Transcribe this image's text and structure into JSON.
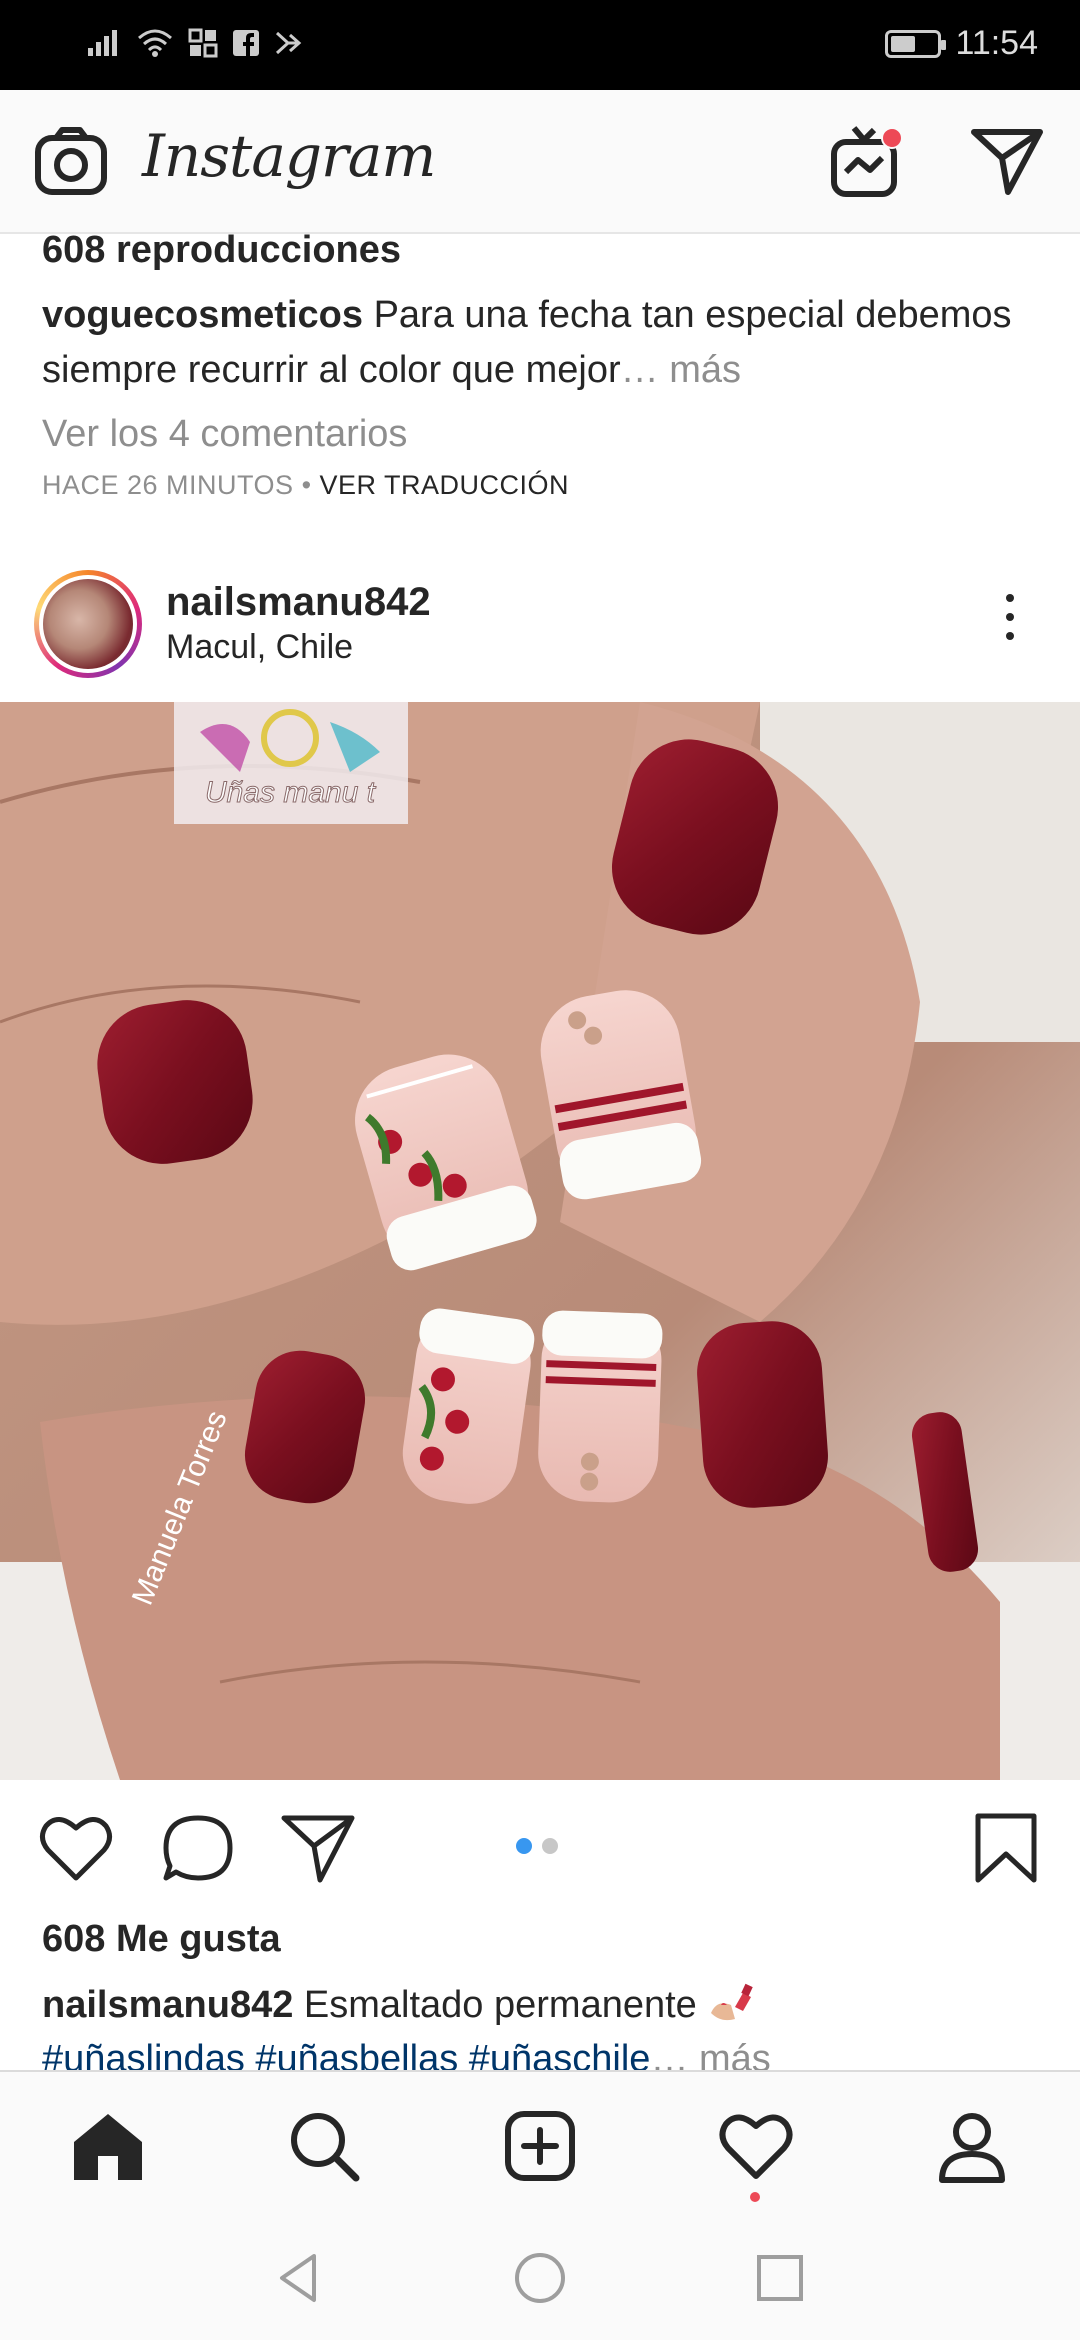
{
  "status_bar": {
    "time": "11:54",
    "icons": [
      "signal-icon",
      "wifi-icon",
      "nfc-icon",
      "facebook-icon",
      "notification-icon",
      "battery-icon"
    ],
    "battery_level": 0.55
  },
  "header": {
    "title": "Instagram",
    "icons": [
      "camera-icon",
      "igtv-icon",
      "direct-message-icon"
    ],
    "igtv_badge_color": "#ed4956"
  },
  "previous_post": {
    "views": "608 reproducciones",
    "username": "voguecosmeticos",
    "caption": "Para una fecha tan especial debemos siempre recurrir al color que mejor",
    "more": "… más",
    "comments_link": "Ver los 4 comentarios",
    "time_ago": "HACE 26 MINUTOS",
    "separator": " • ",
    "translate": "VER TRADUCCIÓN"
  },
  "post": {
    "username": "nailsmanu842",
    "location": "Macul, Chile",
    "image": {
      "watermark_logo": "Uñas manu t",
      "signature": "Manuela Torres"
    },
    "carousel": {
      "count": 2,
      "active": 0
    },
    "likes": "608 Me gusta",
    "caption_username": "nailsmanu842",
    "caption_text": "Esmaltado permanente",
    "caption_emoji": "nail-polish-emoji",
    "hashtags": "#uñaslindas #uñasbellas #uñaschile",
    "more": "… más"
  },
  "colors": {
    "accent_blue": "#3897f0",
    "hashtag_blue": "#003569",
    "notification_red": "#ed4956",
    "text_gray": "#8e8e8e"
  },
  "bottom_nav": [
    "home-icon",
    "search-icon",
    "new-post-icon",
    "activity-icon",
    "profile-icon"
  ],
  "system_nav": [
    "back-icon",
    "home-circle-icon",
    "recents-icon"
  ]
}
